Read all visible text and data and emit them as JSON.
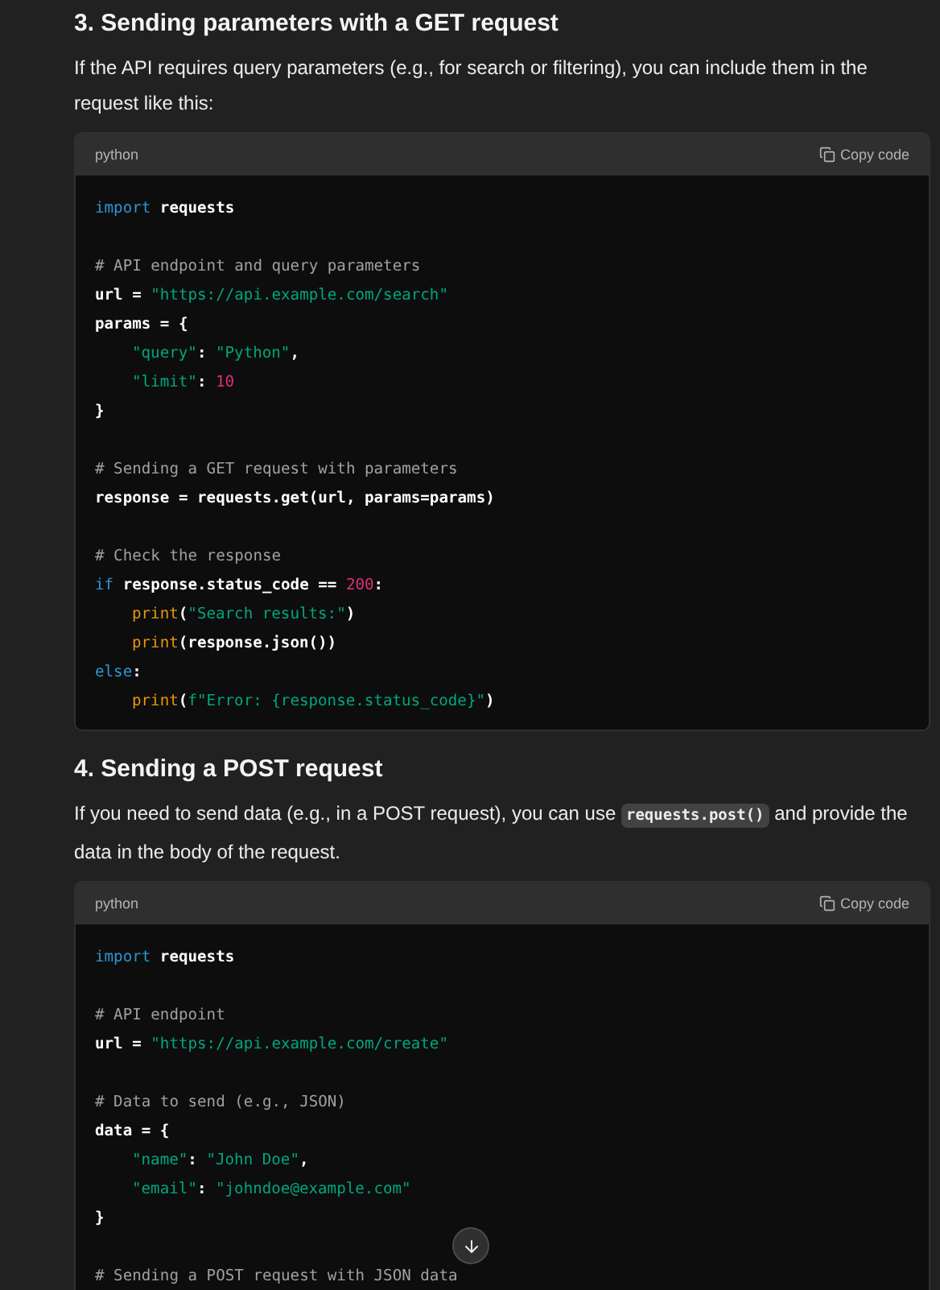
{
  "sections": [
    {
      "heading": "3. Sending parameters with a GET request",
      "paragraph": [
        {
          "kind": "text",
          "text": "If the API requires query parameters (e.g., for search or filtering), you can include them in the request like this:"
        }
      ],
      "code_block": {
        "language": "python",
        "copy_label": "Copy code",
        "groups": [
          [
            {
              "indented": false,
              "tokens": [
                {
                  "kind": "keyword",
                  "text": "import"
                },
                {
                  "kind": "plain",
                  "text": " requests"
                }
              ]
            }
          ],
          [
            {
              "indented": false,
              "tokens": [
                {
                  "kind": "comment",
                  "text": "# API endpoint and query parameters"
                }
              ]
            },
            {
              "indented": false,
              "tokens": [
                {
                  "kind": "plain",
                  "text": "url = "
                },
                {
                  "kind": "string",
                  "text": "\"https://api.example.com/search\""
                }
              ]
            },
            {
              "indented": false,
              "tokens": [
                {
                  "kind": "plain",
                  "text": "params = {"
                }
              ]
            },
            {
              "indented": true,
              "tokens": [
                {
                  "kind": "string",
                  "text": "\"query\""
                },
                {
                  "kind": "plain",
                  "text": ": "
                },
                {
                  "kind": "string",
                  "text": "\"Python\""
                },
                {
                  "kind": "plain",
                  "text": ","
                }
              ]
            },
            {
              "indented": true,
              "tokens": [
                {
                  "kind": "string",
                  "text": "\"limit\""
                },
                {
                  "kind": "plain",
                  "text": ": "
                },
                {
                  "kind": "number",
                  "text": "10"
                }
              ]
            },
            {
              "indented": false,
              "tokens": [
                {
                  "kind": "plain",
                  "text": "}"
                }
              ]
            }
          ],
          [
            {
              "indented": false,
              "tokens": [
                {
                  "kind": "comment",
                  "text": "# Sending a GET request with parameters"
                }
              ]
            },
            {
              "indented": false,
              "tokens": [
                {
                  "kind": "plain",
                  "text": "response = requests.get(url, params=params)"
                }
              ]
            }
          ],
          [
            {
              "indented": false,
              "tokens": [
                {
                  "kind": "comment",
                  "text": "# Check the response"
                }
              ]
            },
            {
              "indented": false,
              "tokens": [
                {
                  "kind": "keyword",
                  "text": "if"
                },
                {
                  "kind": "plain",
                  "text": " response.status_code == "
                },
                {
                  "kind": "number",
                  "text": "200"
                },
                {
                  "kind": "plain",
                  "text": ":"
                }
              ]
            },
            {
              "indented": true,
              "tokens": [
                {
                  "kind": "builtin",
                  "text": "print"
                },
                {
                  "kind": "plain",
                  "text": "("
                },
                {
                  "kind": "string",
                  "text": "\"Search results:\""
                },
                {
                  "kind": "plain",
                  "text": ")"
                }
              ]
            },
            {
              "indented": true,
              "tokens": [
                {
                  "kind": "builtin",
                  "text": "print"
                },
                {
                  "kind": "plain",
                  "text": "(response.json())"
                }
              ]
            },
            {
              "indented": false,
              "tokens": [
                {
                  "kind": "keyword",
                  "text": "else"
                },
                {
                  "kind": "plain",
                  "text": ":"
                }
              ]
            },
            {
              "indented": true,
              "tokens": [
                {
                  "kind": "builtin",
                  "text": "print"
                },
                {
                  "kind": "plain",
                  "text": "("
                },
                {
                  "kind": "string",
                  "text": "f\"Error: {response.status_code}\""
                },
                {
                  "kind": "plain",
                  "text": ")"
                }
              ]
            }
          ]
        ]
      }
    },
    {
      "heading": "4. Sending a POST request",
      "paragraph": [
        {
          "kind": "text",
          "text": "If you need to send data (e.g., in a POST request), you can use "
        },
        {
          "kind": "code",
          "text": "requests.post()"
        },
        {
          "kind": "text",
          "text": " and provide the data in the body of the request."
        }
      ],
      "code_block": {
        "language": "python",
        "copy_label": "Copy code",
        "groups": [
          [
            {
              "indented": false,
              "tokens": [
                {
                  "kind": "keyword",
                  "text": "import"
                },
                {
                  "kind": "plain",
                  "text": " requests"
                }
              ]
            }
          ],
          [
            {
              "indented": false,
              "tokens": [
                {
                  "kind": "comment",
                  "text": "# API endpoint"
                }
              ]
            },
            {
              "indented": false,
              "tokens": [
                {
                  "kind": "plain",
                  "text": "url = "
                },
                {
                  "kind": "string",
                  "text": "\"https://api.example.com/create\""
                }
              ]
            }
          ],
          [
            {
              "indented": false,
              "tokens": [
                {
                  "kind": "comment",
                  "text": "# Data to send (e.g., JSON)"
                }
              ]
            },
            {
              "indented": false,
              "tokens": [
                {
                  "kind": "plain",
                  "text": "data = {"
                }
              ]
            },
            {
              "indented": true,
              "tokens": [
                {
                  "kind": "string",
                  "text": "\"name\""
                },
                {
                  "kind": "plain",
                  "text": ": "
                },
                {
                  "kind": "string",
                  "text": "\"John Doe\""
                },
                {
                  "kind": "plain",
                  "text": ","
                }
              ]
            },
            {
              "indented": true,
              "tokens": [
                {
                  "kind": "string",
                  "text": "\"email\""
                },
                {
                  "kind": "plain",
                  "text": ": "
                },
                {
                  "kind": "string",
                  "text": "\"johndoe@example.com\""
                }
              ]
            },
            {
              "indented": false,
              "tokens": [
                {
                  "kind": "plain",
                  "text": "}"
                }
              ]
            }
          ],
          [
            {
              "indented": false,
              "tokens": [
                {
                  "kind": "comment",
                  "text": "# Sending a POST request with JSON data"
                }
              ]
            }
          ]
        ]
      }
    }
  ]
}
